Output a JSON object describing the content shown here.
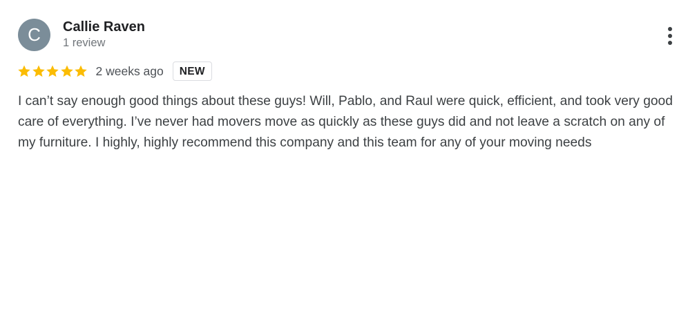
{
  "review": {
    "avatar_initial": "C",
    "avatar_color": "#7b8d99",
    "author_name": "Callie Raven",
    "review_count": "1 review",
    "rating": 5,
    "rating_max": 5,
    "star_color": "#fbbc04",
    "time_ago": "2 weeks ago",
    "badge": "NEW",
    "text": "I can’t say enough good things about these guys! Will, Pablo, and Raul were quick, efficient, and took very good care of everything. I’ve never had movers move as quickly as these guys did and not leave a scratch on any of my furniture. I highly, highly recommend this company and this team for any of your moving needs",
    "more_icon": "more-vert-icon"
  }
}
